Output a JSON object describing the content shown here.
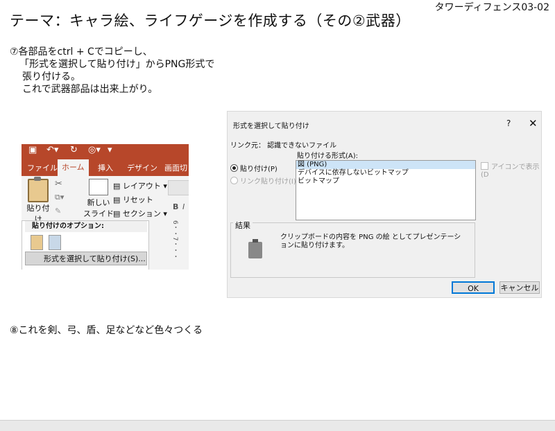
{
  "header_code": "タワーディフェンス03-02",
  "title": "テーマ：キャラ絵、ライフゲージを作成する（その②武器）",
  "step7": {
    "line1": "⑦各部品をctrl + Cでコピーし、",
    "line2": "「形式を選択して貼り付け」からPNG形式で",
    "line3": "張り付ける。",
    "line4": "これで武器部品は出来上がり。"
  },
  "step8": "⑧これを剣、弓、盾、足などなど色々つくる",
  "ribbon": {
    "tabs": [
      "ファイル",
      "ホーム",
      "挿入",
      "デザイン",
      "画面切"
    ],
    "active_tab": "ホーム",
    "paste_label": "貼り付け",
    "new_slide_line1": "新しい",
    "new_slide_line2": "スライド ▾",
    "layout": "レイアウト ▾",
    "reset": "リセット",
    "section": "セクション ▾",
    "bold": "B",
    "italic": "I",
    "paste_options_title": "貼り付けのオプション:",
    "paste_special_item": "形式を選択して貼り付け(S)...",
    "ruler": "6・・7・・・",
    "accent_color": "#b7472a"
  },
  "dialog": {
    "title": "形式を選択して貼り付け",
    "help": "?",
    "close": "✕",
    "source_label": "リンク元：  認識できないファイル",
    "as_label": "貼り付ける形式(A):",
    "radio_paste": "貼り付け(P)",
    "radio_link": "リンク貼り付け(I)",
    "formats": [
      "図 (PNG)",
      "デバイスに依存しないビットマップ",
      "ビットマップ"
    ],
    "selected_format": "図 (PNG)",
    "display_as_icon": "アイコンで表示(D",
    "result_title": "結果",
    "result_text": "クリップボードの内容を PNG の絵 としてプレゼンテーションに貼り付けます。",
    "ok": "OK",
    "cancel": "キャンセル"
  }
}
